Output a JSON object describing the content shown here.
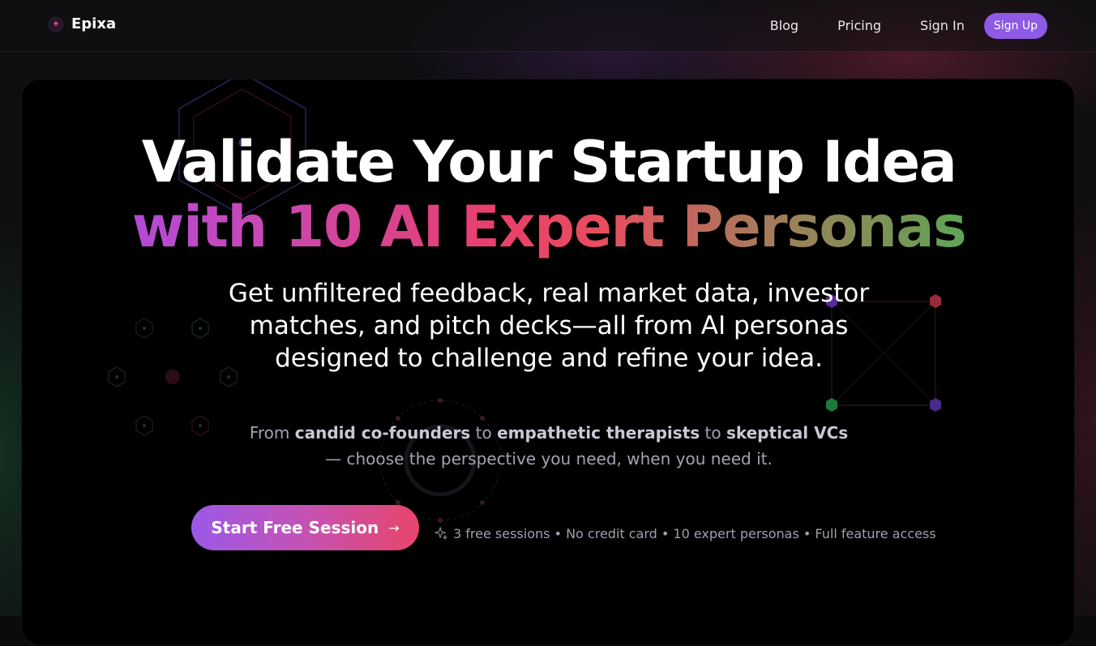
{
  "header": {
    "brand_name": "Epixa",
    "brand_icon": "sparkle-logo-icon",
    "nav": {
      "blog": "Blog",
      "pricing": "Pricing",
      "sign_in": "Sign In",
      "sign_up": "Sign Up"
    }
  },
  "hero": {
    "title_line1": "Validate Your Startup Idea",
    "title_line2": "with 10 AI Expert Personas",
    "subtitle": "Get unfiltered feedback, real market data, investor matches, and pitch decks—all from AI personas designed to challenge and refine your idea.",
    "desc_parts": {
      "p1": "From ",
      "b1": "candid co-founders",
      "p2": " to ",
      "b2": "empathetic therapists",
      "p3": " to ",
      "b3": "skeptical VCs",
      "p4": "— choose the perspective you need, when you need it."
    },
    "cta_label": "Start Free Session",
    "cta_arrow": "→",
    "cta_note": "3 free sessions • No credit card • 10 expert personas • Full feature access"
  },
  "colors": {
    "accent_purple": "#8e5ae6",
    "gradient_start": "#9d4df0",
    "gradient_mid": "#e8406a",
    "gradient_end": "#38c25a"
  }
}
